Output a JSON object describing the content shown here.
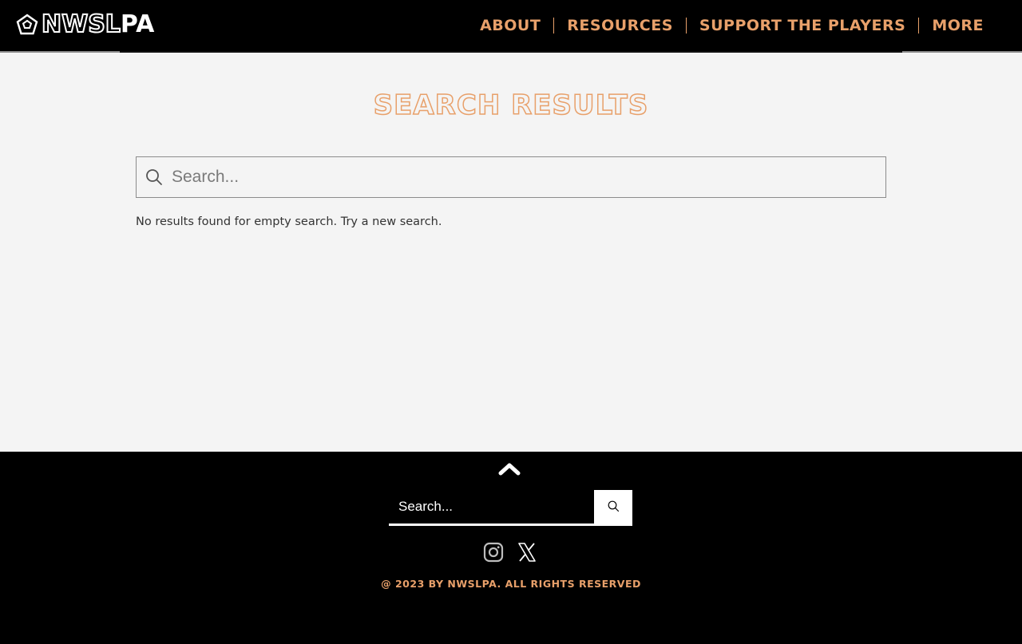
{
  "brand": {
    "logo_part1": "NWSL",
    "logo_part2": "PA",
    "logo_icon": "pentagon-logo-icon"
  },
  "nav": {
    "items": [
      {
        "label": "ABOUT"
      },
      {
        "label": "RESOURCES"
      },
      {
        "label": "SUPPORT THE PLAYERS"
      },
      {
        "label": "MORE"
      }
    ]
  },
  "main": {
    "title": "SEARCH RESULTS",
    "search": {
      "placeholder": "Search...",
      "value": "",
      "icon": "search-icon"
    },
    "message": "No results found for empty search. Try a new search."
  },
  "footer": {
    "back_to_top_icon": "chevron-up-icon",
    "search": {
      "placeholder": "Search...",
      "button_icon": "search-icon"
    },
    "social": [
      {
        "icon": "instagram-icon"
      },
      {
        "icon": "x-twitter-icon"
      }
    ],
    "copyright": "@ 2023 BY NWSLPA.  ALL RIGHTS RESERVED"
  },
  "colors": {
    "accent": "#e8a06a",
    "header_bg": "#000000",
    "page_bg": "#f4f4f4"
  }
}
